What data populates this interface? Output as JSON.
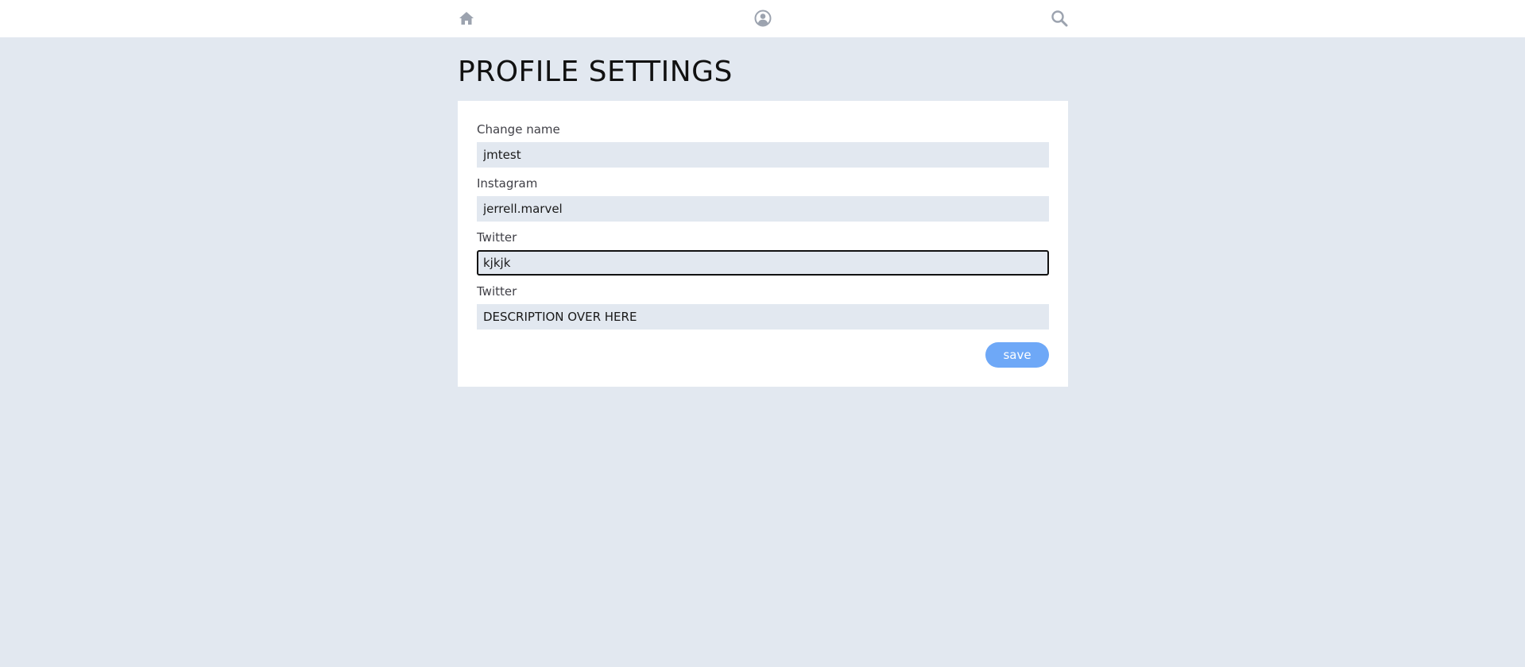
{
  "nav": {
    "items": [
      {
        "icon": "home-icon"
      },
      {
        "icon": "user-icon"
      },
      {
        "icon": "search-icon"
      }
    ]
  },
  "page": {
    "title": "PROFILE SETTINGS"
  },
  "form": {
    "fields": [
      {
        "label": "Change name",
        "value": "jmtest"
      },
      {
        "label": "Instagram",
        "value": "jerrell.marvel"
      },
      {
        "label": "Twitter",
        "value": "kjkjk"
      },
      {
        "label": "Twitter",
        "value": "DESCRIPTION OVER HERE"
      }
    ],
    "save_label": "save"
  },
  "colors": {
    "background": "#e2e8f0",
    "card": "#ffffff",
    "accent": "#6ea8f7",
    "icon": "#9ca3af"
  }
}
